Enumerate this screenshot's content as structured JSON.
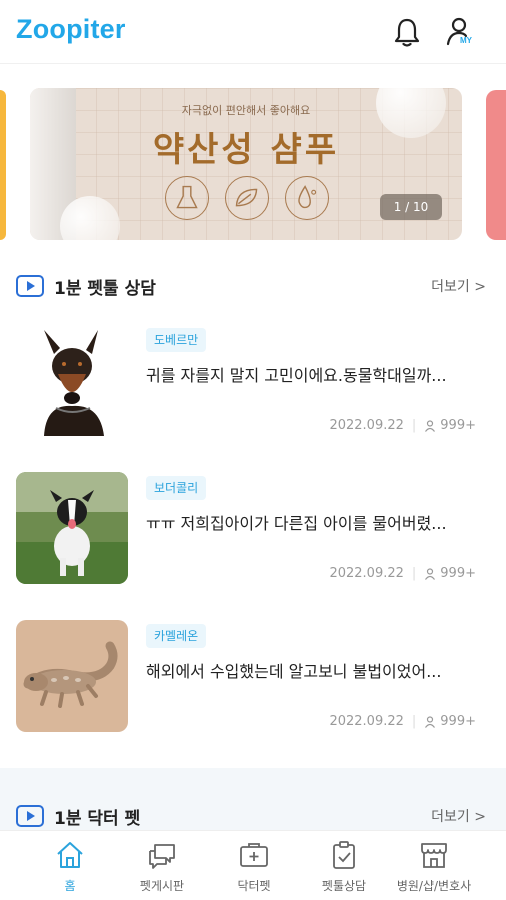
{
  "app": {
    "logo": "Zoopiter",
    "my_badge": "MY"
  },
  "banner": {
    "subtitle": "자극없이 편안해서 좋아해요",
    "title": "약산성 샴푸",
    "counter": "1 / 10",
    "colors": {
      "brand": "#22a7e8",
      "title": "#a36b2b"
    }
  },
  "consult": {
    "title": "1분 펫툴 상담",
    "more": "더보기 >",
    "items": [
      {
        "tag": "도베르만",
        "title": "귀를 자를지 말지 고민이에요.동물학대일까...",
        "date": "2022.09.22",
        "views": "999+"
      },
      {
        "tag": "보더콜리",
        "title": "ㅠㅠ 저희집아이가 다른집 아이를 물어버렸...",
        "date": "2022.09.22",
        "views": "999+"
      },
      {
        "tag": "카멜레온",
        "title": "해외에서 수입했는데 알고보니 불법이었어...",
        "date": "2022.09.22",
        "views": "999+"
      }
    ]
  },
  "doctor": {
    "title": "1분 닥터 펫",
    "more": "더보기 >"
  },
  "nav": [
    {
      "label": "홈",
      "icon": "home-icon"
    },
    {
      "label": "펫게시판",
      "icon": "chat-icon"
    },
    {
      "label": "닥터펫",
      "icon": "medical-kit-icon"
    },
    {
      "label": "펫툴상담",
      "icon": "clipboard-icon"
    },
    {
      "label": "병원/샵/변호사",
      "icon": "store-icon"
    }
  ]
}
